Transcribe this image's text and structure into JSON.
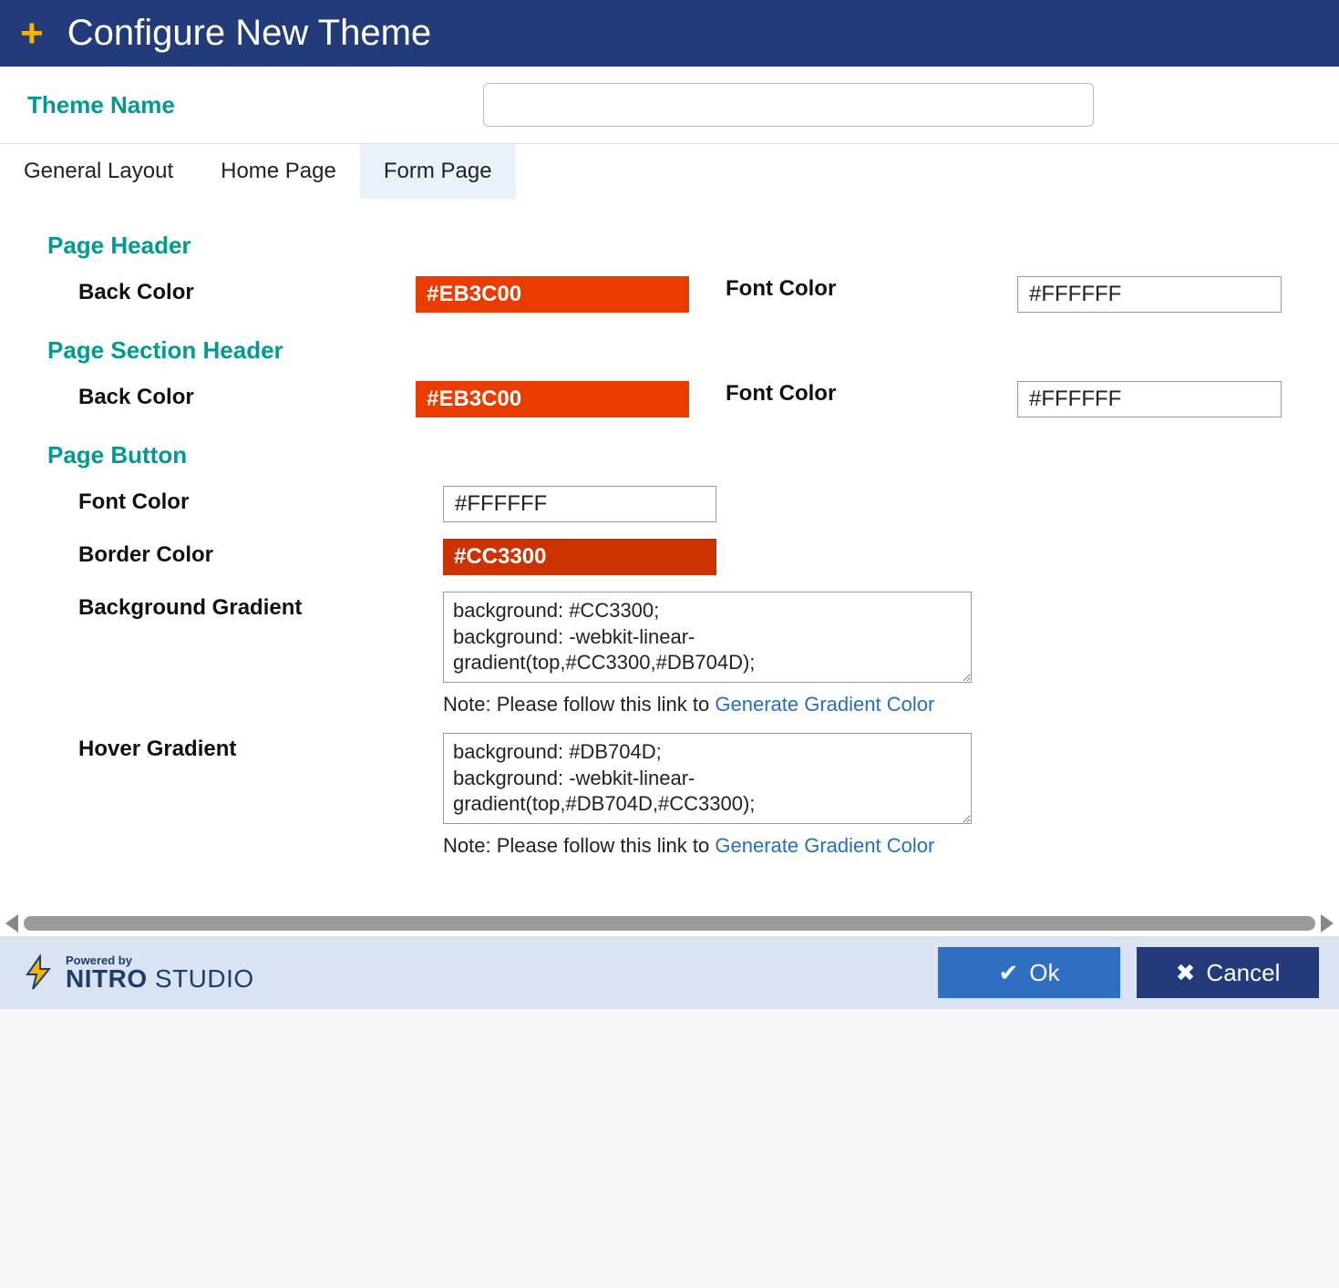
{
  "header": {
    "icon": "plus",
    "title": "Configure New Theme"
  },
  "themeName": {
    "label": "Theme Name",
    "value": ""
  },
  "tabs": [
    {
      "label": "General Layout",
      "active": false
    },
    {
      "label": "Home Page",
      "active": false
    },
    {
      "label": "Form Page",
      "active": true
    }
  ],
  "sections": {
    "pageHeader": {
      "title": "Page Header",
      "backColor": {
        "label": "Back Color",
        "value": "#EB3C00"
      },
      "fontColor": {
        "label": "Font Color",
        "value": "#FFFFFF"
      }
    },
    "pageSectionHeader": {
      "title": "Page Section Header",
      "backColor": {
        "label": "Back Color",
        "value": "#EB3C00"
      },
      "fontColor": {
        "label": "Font Color",
        "value": "#FFFFFF"
      }
    },
    "pageButton": {
      "title": "Page Button",
      "fontColor": {
        "label": "Font Color",
        "value": "#FFFFFF"
      },
      "borderColor": {
        "label": "Border Color",
        "value": "#CC3300"
      },
      "backgroundGradient": {
        "label": "Background Gradient",
        "value": "background: #CC3300;\nbackground: -webkit-linear-gradient(top,#CC3300,#DB704D);",
        "notePrefix": "Note: Please follow this link to ",
        "noteLink": "Generate Gradient Color"
      },
      "hoverGradient": {
        "label": "Hover Gradient",
        "value": "background: #DB704D;\nbackground: -webkit-linear-gradient(top,#DB704D,#CC3300);",
        "notePrefix": "Note: Please follow this link to ",
        "noteLink": "Generate Gradient Color"
      }
    }
  },
  "footer": {
    "poweredBy": "Powered by",
    "brandBold": "NITRO",
    "brandLight": " STUDIO",
    "ok": "Ok",
    "cancel": "Cancel"
  }
}
